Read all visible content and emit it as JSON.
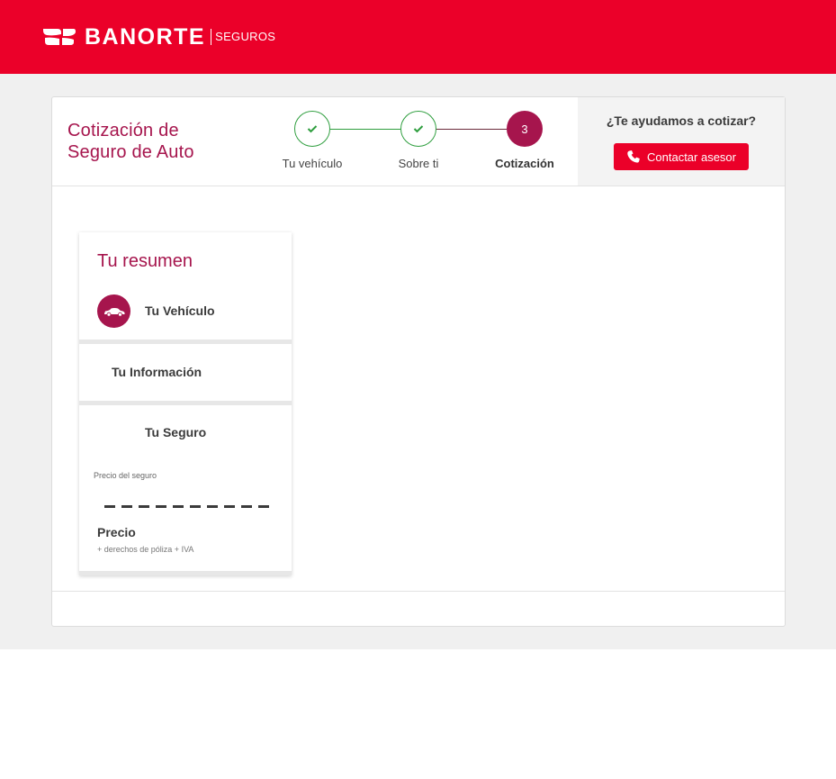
{
  "brand": {
    "name": "BANORTE",
    "sub": "SEGUROS",
    "color": "#eb0029",
    "accent": "#a6154d"
  },
  "header": {
    "title_line1": "Cotización de",
    "title_line2": "Seguro de Auto"
  },
  "stepper": {
    "steps": [
      {
        "label": "Tu vehículo",
        "state": "done"
      },
      {
        "label": "Sobre ti",
        "state": "done"
      },
      {
        "label": "Cotización",
        "state": "active",
        "number": "3"
      }
    ]
  },
  "help": {
    "question": "¿Te ayudamos a cotizar?",
    "button_label": "Contactar asesor"
  },
  "summary": {
    "title": "Tu resumen",
    "vehicle_label": "Tu Vehículo",
    "info_label": "Tu Información",
    "insurance_label": "Tu Seguro",
    "price_caption": "Precio del seguro",
    "price_label": "Precio",
    "price_note": "+ derechos de póliza + IVA"
  },
  "icons": [
    "banorte-logo-icon",
    "phone-icon",
    "check-icon",
    "car-icon"
  ]
}
